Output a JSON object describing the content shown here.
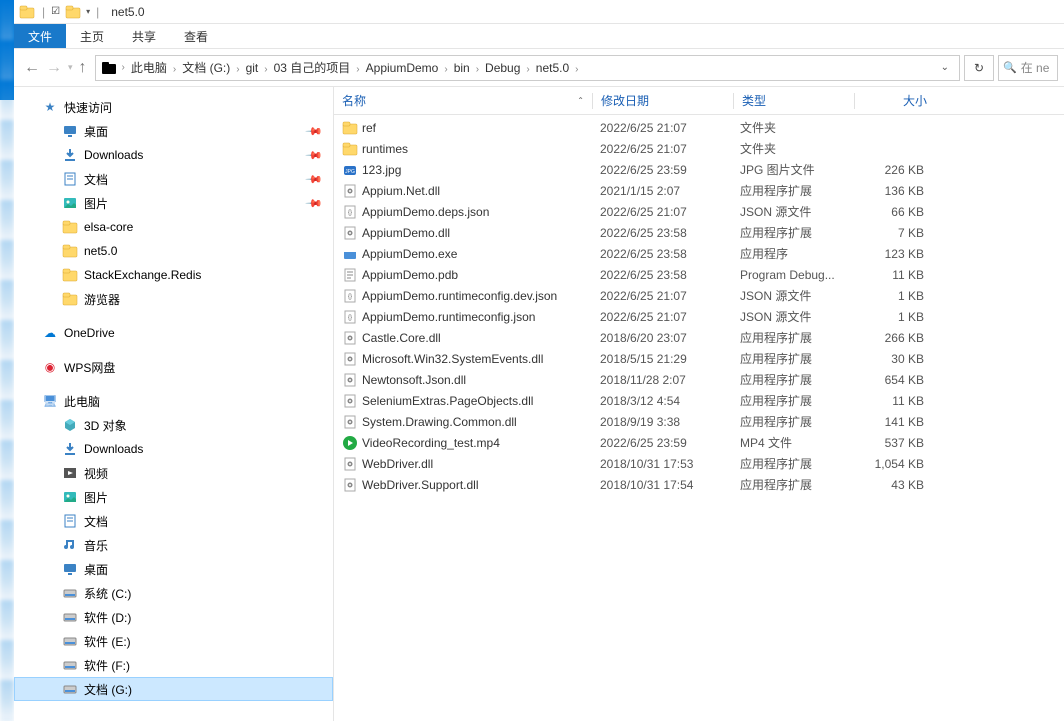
{
  "window": {
    "title": "net5.0"
  },
  "ribbon": {
    "file": "文件",
    "tabs": [
      "主页",
      "共享",
      "查看"
    ]
  },
  "breadcrumb": [
    "此电脑",
    "文档 (G:)",
    "git",
    "03 自己的项目",
    "AppiumDemo",
    "bin",
    "Debug",
    "net5.0"
  ],
  "search": {
    "placeholder": "在 ne"
  },
  "sidebar": {
    "quick": {
      "label": "快速访问"
    },
    "quick_items": [
      {
        "icon": "desktop",
        "label": "桌面",
        "pinned": true
      },
      {
        "icon": "download",
        "label": "Downloads",
        "pinned": true
      },
      {
        "icon": "document",
        "label": "文档",
        "pinned": true
      },
      {
        "icon": "picture",
        "label": "图片",
        "pinned": true
      },
      {
        "icon": "folder",
        "label": "elsa-core"
      },
      {
        "icon": "folder",
        "label": "net5.0"
      },
      {
        "icon": "folder",
        "label": "StackExchange.Redis"
      },
      {
        "icon": "folder",
        "label": "游览器"
      }
    ],
    "onedrive": {
      "label": "OneDrive"
    },
    "wps": {
      "label": "WPS网盘"
    },
    "thispc": {
      "label": "此电脑"
    },
    "pc_items": [
      {
        "icon": "3d",
        "label": "3D 对象"
      },
      {
        "icon": "download",
        "label": "Downloads"
      },
      {
        "icon": "video",
        "label": "视频"
      },
      {
        "icon": "picture",
        "label": "图片"
      },
      {
        "icon": "document",
        "label": "文档"
      },
      {
        "icon": "music",
        "label": "音乐"
      },
      {
        "icon": "desktop",
        "label": "桌面"
      },
      {
        "icon": "disk",
        "label": "系统 (C:)"
      },
      {
        "icon": "disk",
        "label": "软件 (D:)"
      },
      {
        "icon": "disk",
        "label": "软件 (E:)"
      },
      {
        "icon": "disk",
        "label": "软件 (F:)"
      },
      {
        "icon": "disk",
        "label": "文档 (G:)",
        "selected": true
      }
    ]
  },
  "columns": {
    "name": "名称",
    "date": "修改日期",
    "type": "类型",
    "size": "大小"
  },
  "files": [
    {
      "icon": "folder",
      "name": "ref",
      "date": "2022/6/25 21:07",
      "type": "文件夹",
      "size": ""
    },
    {
      "icon": "folder",
      "name": "runtimes",
      "date": "2022/6/25 21:07",
      "type": "文件夹",
      "size": ""
    },
    {
      "icon": "jpg",
      "name": "123.jpg",
      "date": "2022/6/25 23:59",
      "type": "JPG 图片文件",
      "size": "226 KB"
    },
    {
      "icon": "dll",
      "name": "Appium.Net.dll",
      "date": "2021/1/15 2:07",
      "type": "应用程序扩展",
      "size": "136 KB"
    },
    {
      "icon": "json",
      "name": "AppiumDemo.deps.json",
      "date": "2022/6/25 21:07",
      "type": "JSON 源文件",
      "size": "66 KB"
    },
    {
      "icon": "dll",
      "name": "AppiumDemo.dll",
      "date": "2022/6/25 23:58",
      "type": "应用程序扩展",
      "size": "7 KB"
    },
    {
      "icon": "exe",
      "name": "AppiumDemo.exe",
      "date": "2022/6/25 23:58",
      "type": "应用程序",
      "size": "123 KB"
    },
    {
      "icon": "pdb",
      "name": "AppiumDemo.pdb",
      "date": "2022/6/25 23:58",
      "type": "Program Debug...",
      "size": "11 KB"
    },
    {
      "icon": "json",
      "name": "AppiumDemo.runtimeconfig.dev.json",
      "date": "2022/6/25 21:07",
      "type": "JSON 源文件",
      "size": "1 KB"
    },
    {
      "icon": "json",
      "name": "AppiumDemo.runtimeconfig.json",
      "date": "2022/6/25 21:07",
      "type": "JSON 源文件",
      "size": "1 KB"
    },
    {
      "icon": "dll",
      "name": "Castle.Core.dll",
      "date": "2018/6/20 23:07",
      "type": "应用程序扩展",
      "size": "266 KB"
    },
    {
      "icon": "dll",
      "name": "Microsoft.Win32.SystemEvents.dll",
      "date": "2018/5/15 21:29",
      "type": "应用程序扩展",
      "size": "30 KB"
    },
    {
      "icon": "dll",
      "name": "Newtonsoft.Json.dll",
      "date": "2018/11/28 2:07",
      "type": "应用程序扩展",
      "size": "654 KB"
    },
    {
      "icon": "dll",
      "name": "SeleniumExtras.PageObjects.dll",
      "date": "2018/3/12 4:54",
      "type": "应用程序扩展",
      "size": "11 KB"
    },
    {
      "icon": "dll",
      "name": "System.Drawing.Common.dll",
      "date": "2018/9/19 3:38",
      "type": "应用程序扩展",
      "size": "141 KB"
    },
    {
      "icon": "mp4",
      "name": "VideoRecording_test.mp4",
      "date": "2022/6/25 23:59",
      "type": "MP4 文件",
      "size": "537 KB"
    },
    {
      "icon": "dll",
      "name": "WebDriver.dll",
      "date": "2018/10/31 17:53",
      "type": "应用程序扩展",
      "size": "1,054 KB"
    },
    {
      "icon": "dll",
      "name": "WebDriver.Support.dll",
      "date": "2018/10/31 17:54",
      "type": "应用程序扩展",
      "size": "43 KB"
    }
  ]
}
